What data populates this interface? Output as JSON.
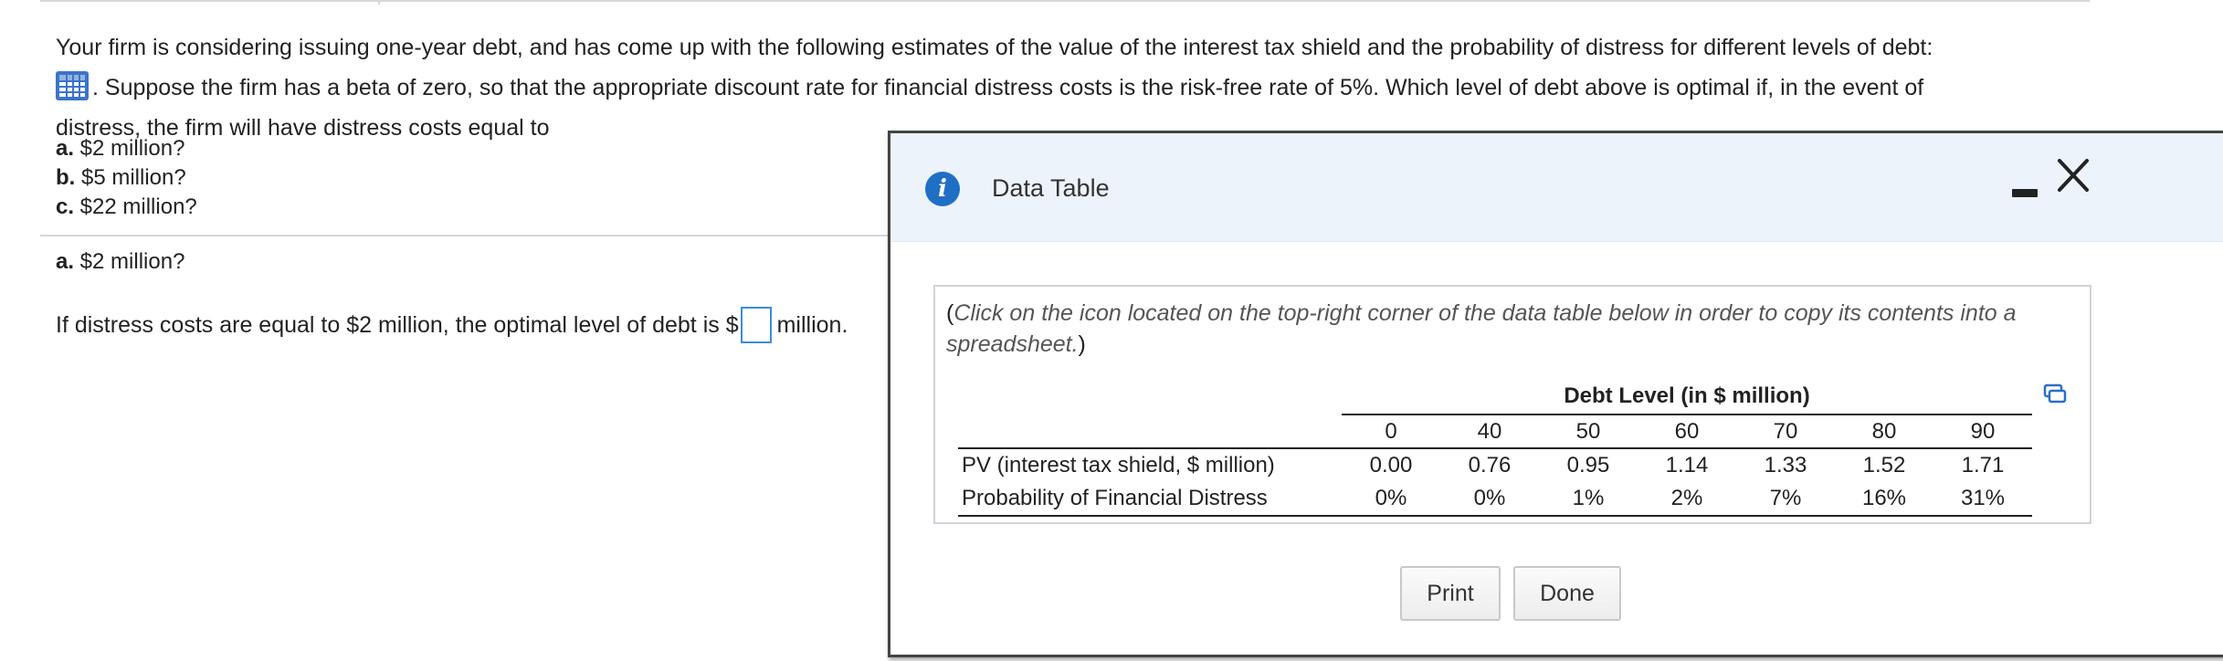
{
  "question": {
    "line1": "Your firm is considering issuing one-year debt, and has come up with the following estimates of the value of the interest tax shield and the probability of distress for different levels of debt:",
    "line2": ". Suppose the firm has a beta of zero, so that the appropriate discount rate for financial distress costs is the risk-free rate of 5%. Which level of debt above is optimal if, in the event of",
    "line3": "distress, the firm will have distress costs equal to",
    "choices": [
      {
        "label": "a.",
        "text": " $2 million?"
      },
      {
        "label": "b.",
        "text": " $5 million?"
      },
      {
        "label": "c.",
        "text": " $22 million?"
      }
    ]
  },
  "part_a": {
    "label": "a.",
    "text": " $2 million?",
    "answer_prefix": "If distress costs are equal to $2 million, the optimal level of debt is $",
    "answer_value": "",
    "answer_suffix": "million."
  },
  "dialog": {
    "title": "Data Table",
    "instruction_open": "(",
    "instruction": "Click on the icon located on the top-right corner of the data table below in order to copy its contents into a spreadsheet.",
    "instruction_close": ")",
    "table": {
      "header": "Debt Level (in $ million)",
      "levels": [
        "0",
        "40",
        "50",
        "60",
        "70",
        "80",
        "90"
      ],
      "rows": [
        {
          "label": "PV (interest tax shield, $ million)",
          "values": [
            "0.00",
            "0.76",
            "0.95",
            "1.14",
            "1.33",
            "1.52",
            "1.71"
          ]
        },
        {
          "label": "Probability of Financial Distress",
          "values": [
            "0%",
            "0%",
            "1%",
            "2%",
            "7%",
            "16%",
            "31%"
          ]
        }
      ]
    },
    "buttons": {
      "print": "Print",
      "done": "Done"
    }
  },
  "colors": {
    "accent": "#1f6fc5",
    "header_bg": "#edf3fb",
    "input_border": "#3a8ed9"
  },
  "icons": [
    "grid-table-icon",
    "info-icon",
    "minimize-icon",
    "close-icon",
    "copy-icon"
  ]
}
